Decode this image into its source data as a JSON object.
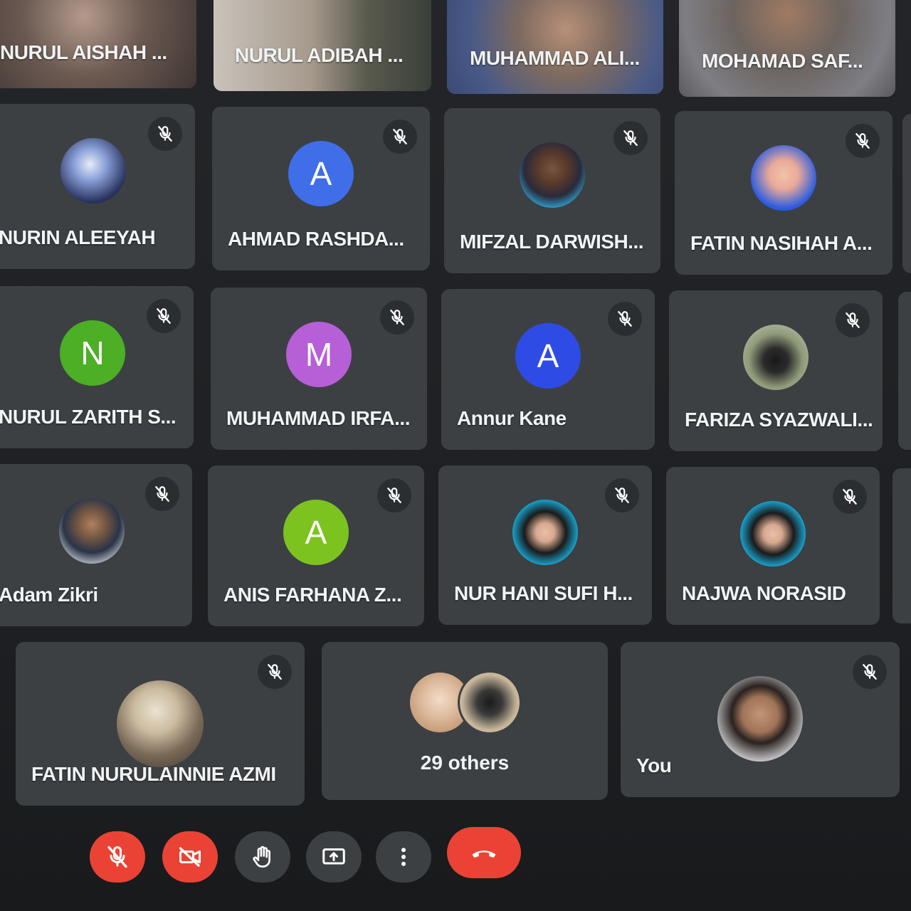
{
  "video_tiles": [
    {
      "name": "NURUL AISHAH ...",
      "bg": "#6b5a52"
    },
    {
      "name": "NURUL ADIBAH ...",
      "bg": "#8c8478"
    },
    {
      "name": "MUHAMMAD ALI...",
      "bg": "#5a6a86"
    },
    {
      "name": "MOHAMAD SAF...",
      "bg": "#6c6460"
    }
  ],
  "participants": [
    {
      "name": "NURIN ALEEYAH",
      "avatar_type": "photo",
      "avatar_color": "#3a4a7a",
      "initial": ""
    },
    {
      "name": "AHMAD RASHDA...",
      "avatar_type": "initial",
      "avatar_color": "#3f6ee8",
      "initial": "A"
    },
    {
      "name": "MIFZAL DARWISH...",
      "avatar_type": "photo",
      "avatar_color": "#2fa6d8",
      "initial": ""
    },
    {
      "name": "FATIN NASIHAH A...",
      "avatar_type": "photo",
      "avatar_color": "#2a5be0",
      "initial": ""
    },
    {
      "name": "NURUL ZARITH S...",
      "avatar_type": "initial",
      "avatar_color": "#4caf25",
      "initial": "N"
    },
    {
      "name": "MUHAMMAD IRFA...",
      "avatar_type": "initial",
      "avatar_color": "#b65fd6",
      "initial": "M"
    },
    {
      "name": "Annur Kane",
      "avatar_type": "initial",
      "avatar_color": "#2f4be6",
      "initial": "A"
    },
    {
      "name": "FARIZA SYAZWALI...",
      "avatar_type": "photo",
      "avatar_color": "#7d8a6a",
      "initial": ""
    },
    {
      "name": "Adam Zikri",
      "avatar_type": "photo",
      "avatar_color": "#9aa0a6",
      "initial": ""
    },
    {
      "name": "ANIS FARHANA Z...",
      "avatar_type": "initial",
      "avatar_color": "#7cc31f",
      "initial": "A"
    },
    {
      "name": "NUR HANI SUFI H...",
      "avatar_type": "photo",
      "avatar_color": "#17b7e8",
      "initial": ""
    },
    {
      "name": "NAJWA NORASID",
      "avatar_type": "photo",
      "avatar_color": "#19b8ea",
      "initial": ""
    },
    {
      "name": "FATIN NURULAINNIE AZMI",
      "avatar_type": "photo",
      "avatar_color": "#b9aa92",
      "initial": ""
    }
  ],
  "others": {
    "label": "29 others"
  },
  "self": {
    "name": "You"
  },
  "controls": {
    "mic_muted": true,
    "camera_off": true,
    "accent_red": "#ea4335",
    "button_gray": "#3c4043"
  }
}
